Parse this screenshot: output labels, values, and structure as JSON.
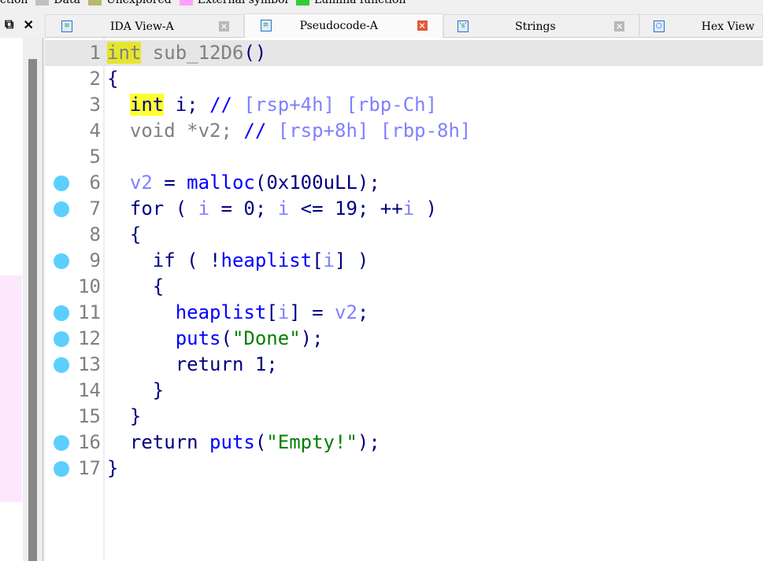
{
  "legend": [
    {
      "label": "ction",
      "color": null
    },
    {
      "label": "Data",
      "color": "#c0c0c0"
    },
    {
      "label": "Unexplored",
      "color": "#b8b870"
    },
    {
      "label": "External symbol",
      "color": "#ffa0ff"
    },
    {
      "label": "Lumina function",
      "color": "#33cc33"
    }
  ],
  "panel": {
    "restore_icon": "⧉",
    "close_icon": "✕"
  },
  "tabs": [
    {
      "label": "IDA View-A",
      "icon": "doc-icon",
      "active": false
    },
    {
      "label": "Pseudocode-A",
      "icon": "doc-icon",
      "active": true
    },
    {
      "label": "Strings",
      "icon": "strings-icon",
      "active": false
    },
    {
      "label": "Hex View",
      "icon": "hex-icon",
      "active": false
    }
  ],
  "code": [
    {
      "n": "1",
      "bp": false,
      "tokens": [
        [
          "int",
          "gray hl1"
        ],
        [
          " sub_12D6",
          "gray"
        ],
        [
          "()",
          "kw"
        ]
      ]
    },
    {
      "n": "2",
      "bp": false,
      "tokens": [
        [
          "{",
          "kw"
        ]
      ]
    },
    {
      "n": "3",
      "bp": false,
      "tokens": [
        [
          "  ",
          ""
        ],
        [
          "int",
          "kw hl2"
        ],
        [
          " i; ",
          "kw"
        ],
        [
          "//",
          "sl"
        ],
        [
          " [rsp+4h] [rbp-Ch]",
          "cm"
        ]
      ]
    },
    {
      "n": "4",
      "bp": false,
      "tokens": [
        [
          "  void *v2; ",
          "gray"
        ],
        [
          "//",
          "sl"
        ],
        [
          " [rsp+8h] [rbp-8h]",
          "cm"
        ]
      ]
    },
    {
      "n": "5",
      "bp": false,
      "tokens": []
    },
    {
      "n": "6",
      "bp": true,
      "tokens": [
        [
          "  ",
          ""
        ],
        [
          "v2",
          "var"
        ],
        [
          " = ",
          "kw"
        ],
        [
          "malloc",
          "fn"
        ],
        [
          "(0x100uLL);",
          "kw"
        ]
      ]
    },
    {
      "n": "7",
      "bp": true,
      "tokens": [
        [
          "  for ( ",
          "kw"
        ],
        [
          "i",
          "var"
        ],
        [
          " = 0; ",
          "kw"
        ],
        [
          "i",
          "var"
        ],
        [
          " <= 19; ++",
          "kw"
        ],
        [
          "i",
          "var"
        ],
        [
          " )",
          "kw"
        ]
      ]
    },
    {
      "n": "8",
      "bp": false,
      "tokens": [
        [
          "  {",
          "kw"
        ]
      ]
    },
    {
      "n": "9",
      "bp": true,
      "tokens": [
        [
          "    if ( !",
          "kw"
        ],
        [
          "heaplist",
          "fn"
        ],
        [
          "[",
          "kw"
        ],
        [
          "i",
          "var"
        ],
        [
          "] )",
          "kw"
        ]
      ]
    },
    {
      "n": "10",
      "bp": false,
      "tokens": [
        [
          "    {",
          "kw"
        ]
      ]
    },
    {
      "n": "11",
      "bp": true,
      "tokens": [
        [
          "      ",
          ""
        ],
        [
          "heaplist",
          "fn"
        ],
        [
          "[",
          "kw"
        ],
        [
          "i",
          "var"
        ],
        [
          "] = ",
          "kw"
        ],
        [
          "v2",
          "var"
        ],
        [
          ";",
          "kw"
        ]
      ]
    },
    {
      "n": "12",
      "bp": true,
      "tokens": [
        [
          "      ",
          ""
        ],
        [
          "puts",
          "fn"
        ],
        [
          "(",
          "kw"
        ],
        [
          "\"Done\"",
          "str"
        ],
        [
          ");",
          "kw"
        ]
      ]
    },
    {
      "n": "13",
      "bp": true,
      "tokens": [
        [
          "      return 1;",
          "kw"
        ]
      ]
    },
    {
      "n": "14",
      "bp": false,
      "tokens": [
        [
          "    }",
          "kw"
        ]
      ]
    },
    {
      "n": "15",
      "bp": false,
      "tokens": [
        [
          "  }",
          "kw"
        ]
      ]
    },
    {
      "n": "16",
      "bp": true,
      "tokens": [
        [
          "  return ",
          "kw"
        ],
        [
          "puts",
          "fn"
        ],
        [
          "(",
          "kw"
        ],
        [
          "\"Empty!\"",
          "str"
        ],
        [
          ");",
          "kw"
        ]
      ]
    },
    {
      "n": "17",
      "bp": true,
      "tokens": [
        [
          "}",
          "kw"
        ]
      ]
    }
  ]
}
